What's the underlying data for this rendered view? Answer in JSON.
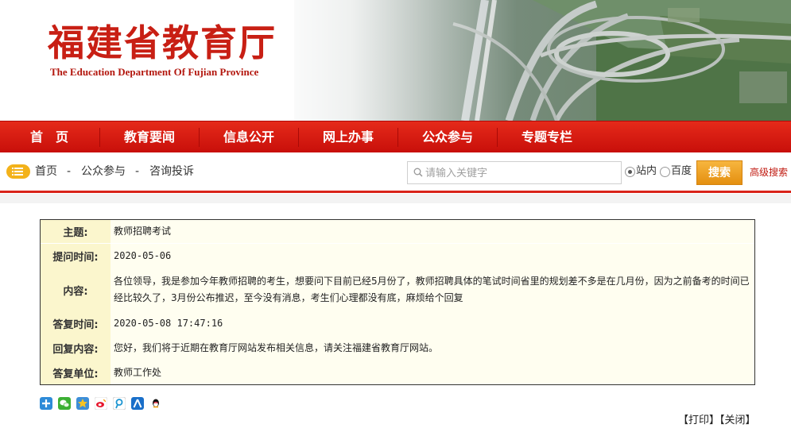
{
  "header": {
    "title": "福建省教育厅",
    "subtitle": "The Education Department Of Fujian Province"
  },
  "nav": {
    "items": [
      {
        "label": "首　页"
      },
      {
        "label": "教育要闻"
      },
      {
        "label": "信息公开"
      },
      {
        "label": "网上办事"
      },
      {
        "label": "公众参与"
      },
      {
        "label": "专题专栏"
      }
    ]
  },
  "breadcrumb": {
    "items": [
      "首页",
      "公众参与",
      "咨询投诉"
    ],
    "separator": "-"
  },
  "search": {
    "placeholder": "请输入关键字",
    "scope_site": "站内",
    "scope_baidu": "百度",
    "selected_scope": "站内",
    "button_label": "搜索",
    "advanced_label": "高级搜索"
  },
  "qa": {
    "subject_label": "主题:",
    "subject_value": "教师招聘考试",
    "ask_time_label": "提问时间:",
    "ask_time_value": "2020-05-06",
    "content_label": "内容:",
    "content_value": "各位领导，我是参加今年教师招聘的考生，想要问下目前已经5月份了，教师招聘具体的笔试时间省里的规划差不多是在几月份，因为之前备考的时间已经比较久了，3月份公布推迟，至今没有消息，考生们心理都没有底，麻烦给个回复",
    "reply_time_label": "答复时间:",
    "reply_time_value": "2020-05-08 17:47:16",
    "reply_content_label": "回复内容:",
    "reply_content_value": "您好，我们将于近期在教育厅网站发布相关信息，请关注福建省教育厅网站。",
    "reply_unit_label": "答复单位:",
    "reply_unit_value": "教师工作处"
  },
  "footer": {
    "print_label": "【打印】",
    "close_label": "【关闭】"
  },
  "colors": {
    "brand_red": "#c81f14",
    "nav_red": "#d81c12",
    "label_bg": "#fbf6cd",
    "search_orange": "#f0a02a"
  },
  "share_icons": [
    "share-more-icon",
    "wechat-icon",
    "qzone-icon",
    "weibo-icon",
    "tencent-weibo-icon",
    "renren-icon",
    "qq-icon"
  ]
}
